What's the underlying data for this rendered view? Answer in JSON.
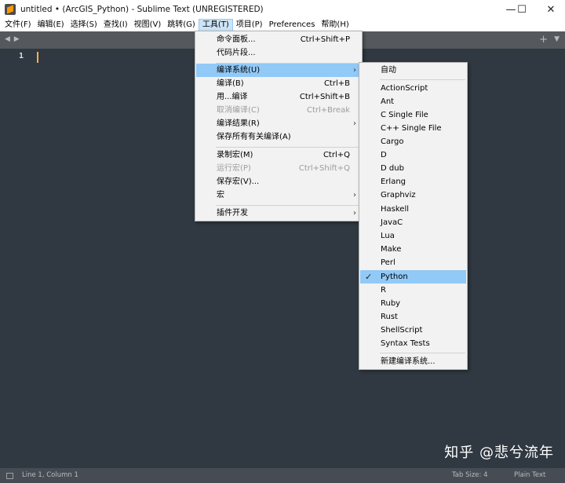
{
  "window": {
    "title": "untitled • (ArcGIS_Python) - Sublime Text (UNREGISTERED)",
    "controls": {
      "minimize": "—",
      "maximize": "☐",
      "close": "✕"
    }
  },
  "menubar": {
    "items": [
      "文件(F)",
      "编辑(E)",
      "选择(S)",
      "查找(I)",
      "视图(V)",
      "跳转(G)",
      "工具(T)",
      "项目(P)",
      "Preferences",
      "帮助(H)"
    ],
    "active": "工具(T)"
  },
  "tabbar": {
    "nav_arrows": "◀ ▶",
    "add": "+",
    "dropdown": "▼"
  },
  "editor": {
    "line_number": "1"
  },
  "tools_menu": {
    "command_palette": {
      "label": "命令面板...",
      "shortcut": "Ctrl+Shift+P"
    },
    "snippets": {
      "label": "代码片段..."
    },
    "build_system": {
      "label": "编译系统(U)"
    },
    "build": {
      "label": "编译(B)",
      "shortcut": "Ctrl+B"
    },
    "build_with": {
      "label": "用...编译",
      "shortcut": "Ctrl+Shift+B"
    },
    "cancel_build": {
      "label": "取消编译(C)",
      "shortcut": "Ctrl+Break"
    },
    "build_results": {
      "label": "编译结果(R)"
    },
    "save_all_on_build": {
      "label": "保存所有有关编译(A)"
    },
    "record_macro": {
      "label": "录制宏(M)",
      "shortcut": "Ctrl+Q"
    },
    "playback_macro": {
      "label": "运行宏(P)",
      "shortcut": "Ctrl+Shift+Q"
    },
    "save_macro": {
      "label": "保存宏(V)..."
    },
    "macros": {
      "label": "宏"
    },
    "developer": {
      "label": "插件开发"
    },
    "submenu_arrow": "›"
  },
  "build_menu": {
    "items": [
      "自动",
      "ActionScript",
      "Ant",
      "C Single File",
      "C++ Single File",
      "Cargo",
      "D",
      "D dub",
      "Erlang",
      "Graphviz",
      "Haskell",
      "JavaC",
      "Lua",
      "Make",
      "Perl",
      "Python",
      "R",
      "Ruby",
      "Rust",
      "ShellScript",
      "Syntax Tests"
    ],
    "selected": "Python",
    "check": "✓",
    "new_build_system": "新建编译系统..."
  },
  "statusbar": {
    "position": "Line 1, Column 1",
    "tab_size": "Tab Size: 4",
    "syntax": "Plain Text"
  },
  "watermark": "知乎 @悲兮流年"
}
